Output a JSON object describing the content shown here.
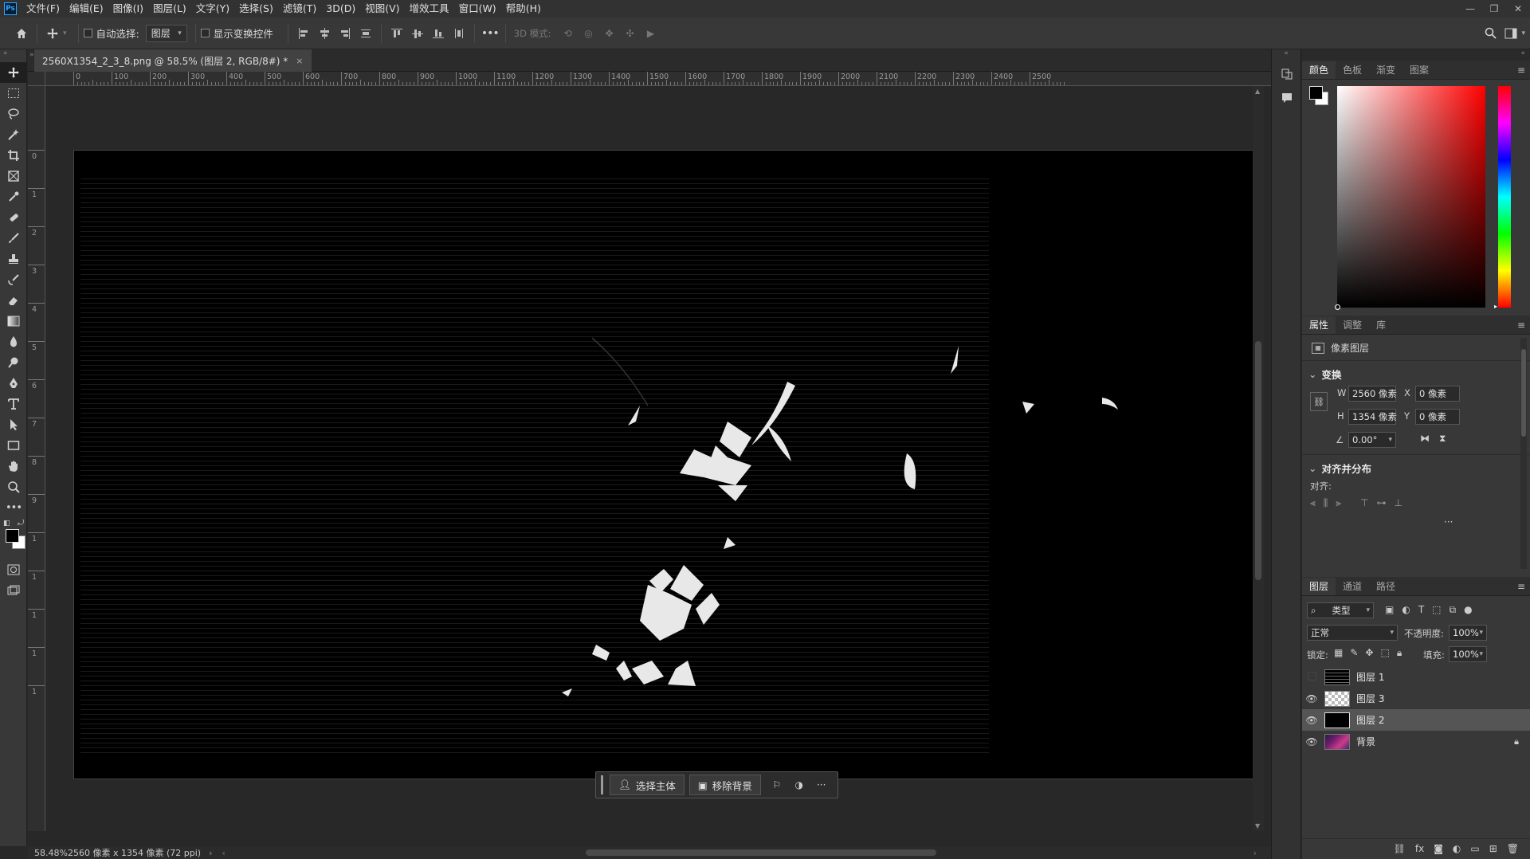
{
  "app": {
    "logo": "Ps",
    "menu": [
      "文件(F)",
      "编辑(E)",
      "图像(I)",
      "图层(L)",
      "文字(Y)",
      "选择(S)",
      "滤镜(T)",
      "3D(D)",
      "视图(V)",
      "增效工具",
      "窗口(W)",
      "帮助(H)"
    ]
  },
  "options_bar": {
    "auto_select_label": "自动选择:",
    "auto_select_value": "图层",
    "show_transform_label": "显示变换控件",
    "mode_3d_label": "3D 模式:"
  },
  "document": {
    "tab_title": "2560X1354_2_3_8.png @ 58.5% (图层 2, RGB/8#) *",
    "close": "×",
    "ruler_top_labels": [
      "0",
      "100",
      "200",
      "300",
      "400",
      "500",
      "600",
      "700",
      "800",
      "900",
      "1000",
      "1100",
      "1200",
      "1300",
      "1400",
      "1500",
      "1600",
      "1700",
      "1800",
      "1900",
      "2000",
      "2100",
      "2200",
      "2300",
      "2400",
      "2500"
    ],
    "ruler_left_labels": [
      "0",
      "1",
      "2",
      "3",
      "4",
      "5",
      "6",
      "7",
      "8",
      "9",
      "1",
      "1",
      "1",
      "1",
      "1"
    ]
  },
  "taskbar": {
    "select_subject": "选择主体",
    "remove_background": "移除背景",
    "more": "···"
  },
  "status": {
    "zoom": "58.48%",
    "info": "2560 像素 x 1354 像素 (72 ppi)"
  },
  "color_panel": {
    "tabs": [
      "颜色",
      "色板",
      "渐变",
      "图案"
    ],
    "foreground": "#000000",
    "background": "#ffffff",
    "hue": "#ff0000"
  },
  "properties_panel": {
    "tabs": [
      "属性",
      "调整",
      "库"
    ],
    "layer_type": "像素图层",
    "transform_title": "变换",
    "w_label": "W",
    "w_value": "2560 像素",
    "h_label": "H",
    "h_value": "1354 像素",
    "x_label": "X",
    "x_value": "0 像素",
    "y_label": "Y",
    "y_value": "0 像素",
    "angle_value": "0.00°",
    "align_title": "对齐并分布",
    "align_label": "对齐:",
    "more": "···"
  },
  "layers_panel": {
    "tabs": [
      "图层",
      "通道",
      "路径"
    ],
    "filter_label": "类型",
    "blend_mode": "正常",
    "opacity_label": "不透明度:",
    "opacity_value": "100%",
    "lock_label": "锁定:",
    "fill_label": "填充:",
    "fill_value": "100%",
    "layers": [
      {
        "name": "图层 1",
        "visible": false,
        "selected": false,
        "locked": false
      },
      {
        "name": "图层 3",
        "visible": true,
        "selected": false,
        "locked": false
      },
      {
        "name": "图层 2",
        "visible": true,
        "selected": true,
        "locked": false
      },
      {
        "name": "背景",
        "visible": true,
        "selected": false,
        "locked": true
      }
    ]
  }
}
